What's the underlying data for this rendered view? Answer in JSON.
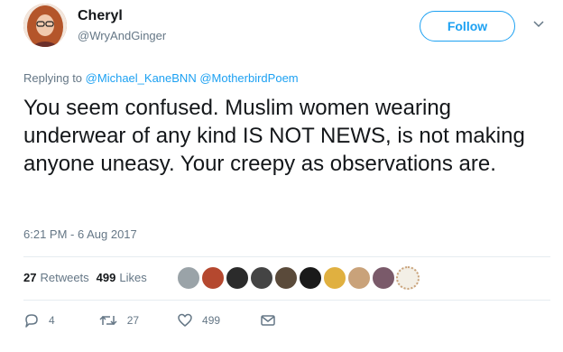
{
  "author": {
    "name": "Cheryl",
    "handle": "@WryAndGinger"
  },
  "follow_button": {
    "label": "Follow"
  },
  "reply_to": {
    "prefix": "Replying to",
    "mentions": [
      "@Michael_KaneBNN",
      "@MotherbirdPoem"
    ]
  },
  "tweet": {
    "text": "You seem confused. Muslim women wearing underwear of any kind IS NOT NEWS, is not making anyone uneasy. Your creepy as observations are.",
    "timestamp": "6:21 PM - 6 Aug 2017"
  },
  "stats": {
    "retweets_count": "27",
    "retweets_label": "Retweets",
    "likes_count": "499",
    "likes_label": "Likes"
  },
  "likers": [
    {
      "name": "liker-avatar-1",
      "color": "#9aa3a8"
    },
    {
      "name": "liker-avatar-2",
      "color": "#b5482f"
    },
    {
      "name": "liker-avatar-3",
      "color": "#2b2b2b"
    },
    {
      "name": "liker-avatar-4",
      "color": "#444444"
    },
    {
      "name": "liker-avatar-5",
      "color": "#5a4a3a"
    },
    {
      "name": "liker-avatar-6",
      "color": "#1a1a1a"
    },
    {
      "name": "liker-avatar-7",
      "color": "#e0b040"
    },
    {
      "name": "liker-avatar-8",
      "color": "#c9a27a"
    },
    {
      "name": "liker-avatar-9",
      "color": "#7a5a6a"
    },
    {
      "name": "liker-avatar-10",
      "color": "#f3efe6"
    }
  ],
  "actions": {
    "reply_count": "4",
    "retweet_count": "27",
    "like_count": "499"
  },
  "colors": {
    "accent": "#1da1f2",
    "secondary_text": "#657786",
    "primary_text": "#14171a",
    "divider": "#e6ecf0"
  },
  "icons": [
    "chevron-down-icon",
    "reply-icon",
    "retweet-icon",
    "heart-icon",
    "message-icon"
  ]
}
